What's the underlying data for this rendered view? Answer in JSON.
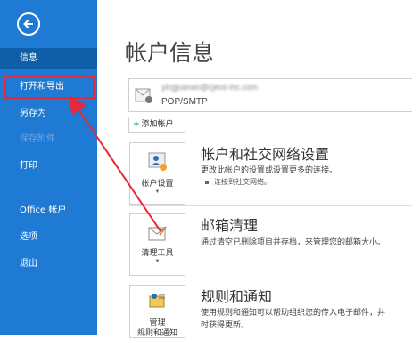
{
  "sidebar": {
    "items": [
      {
        "label": "信息"
      },
      {
        "label": "打开和导出"
      },
      {
        "label": "另存为"
      },
      {
        "label": "保存附件"
      },
      {
        "label": "打印"
      },
      {
        "label": "Office 帐户"
      },
      {
        "label": "选项"
      },
      {
        "label": "退出"
      }
    ]
  },
  "main": {
    "title": "帐户信息",
    "account": {
      "email": "yingjuanan@cjeos-inc.com",
      "type": "POP/SMTP"
    },
    "add_account_label": "添加帐户",
    "sections": [
      {
        "tile_label": "帐户设置",
        "title": "帐户和社交网络设置",
        "description": "更改此帐户的设置或设置更多的连接。",
        "bullet": "连接到社交网络。"
      },
      {
        "tile_label": "清理工具",
        "title": "邮箱清理",
        "description": "通过清空已删除项目并存档，来管理您的邮箱大小。"
      },
      {
        "tile_label_1": "管理",
        "tile_label_2": "规则和通知",
        "title": "规则和通知",
        "description": "使用规则和通知可以帮助组织您的传入电子邮件，并",
        "description_2": "时获得更新。"
      }
    ]
  },
  "colors": {
    "sidebar_bg": "#1f7ad3",
    "sidebar_active": "#0f5ea8",
    "highlight": "#e8273a"
  }
}
